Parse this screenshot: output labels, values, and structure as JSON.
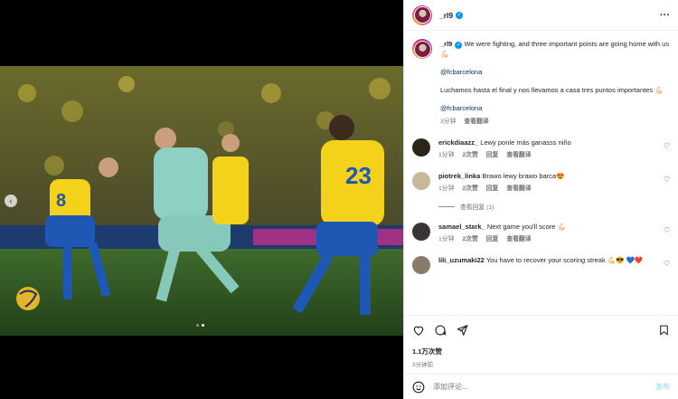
{
  "post": {
    "username": "_rl9",
    "caption": {
      "text_en": "We were fighting, and three important points are going home with us 💪🏻",
      "mention1": "@fcbarcelona",
      "text_es": "Luchamos hasta el final y nos llevamos a casa tres puntos importantes 💪🏻",
      "mention2": "@fcbarcelona",
      "time": "3分钟",
      "translate": "查看翻译"
    },
    "likes": "1.1万次赞",
    "time": "3分钟前",
    "comment_placeholder": "添加评论...",
    "post_label": "发布"
  },
  "comments": [
    {
      "username": "erickdiaazz_",
      "text": "Lewy ponle más ganasss niño",
      "time": "",
      "likes": "",
      "reply": "",
      "translate": "",
      "avatar_color": "#2b2418"
    },
    {
      "username": "piotrek_linka",
      "text": "Brawo lewy brawo barca😍",
      "time": "1分钟",
      "likes": "2次赞",
      "reply": "回复",
      "translate": "查看翻译",
      "avatar_color": "#c9b79c"
    },
    {
      "username": "samael_stark_",
      "text": "Next game you'll score 💪🏻",
      "time": "1分钟",
      "likes": "2次赞",
      "reply": "回复",
      "translate": "查看翻译",
      "avatar_color": "#3a3530"
    },
    {
      "username": "lili_uzumaki22",
      "text": "You have to recover your scoring streak 💪🏻😎 💙❤️",
      "time": "",
      "likes": "",
      "reply": "",
      "translate": "",
      "avatar_color": "#8a7a6a"
    }
  ],
  "comment_meta_first": {
    "time": "1分钟",
    "likes": "2次赞",
    "reply": "回复",
    "translate": "查看翻译"
  },
  "view_replies": "查看回复 (1)",
  "icons": {
    "like": "heart-icon",
    "comment": "comment-icon",
    "share": "share-icon",
    "save": "bookmark-icon",
    "emoji": "emoji-icon",
    "more": "more-icon",
    "prev": "chevron-left-icon"
  },
  "colors": {
    "verified": "#0095f6",
    "mention": "#00376b",
    "post_button": "#b2dffc"
  }
}
